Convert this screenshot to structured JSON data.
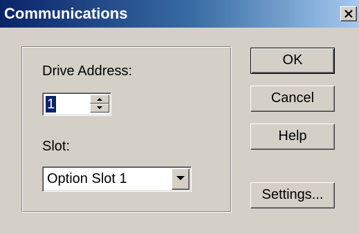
{
  "window": {
    "title": "Communications",
    "close_icon": "close-icon"
  },
  "drive_address": {
    "label": "Drive Address:",
    "value": "1",
    "spin_up_icon": "arrow-up-icon",
    "spin_down_icon": "arrow-down-icon"
  },
  "slot": {
    "label": "Slot:",
    "selected": "Option Slot 1",
    "dropdown_icon": "chevron-down-icon"
  },
  "buttons": {
    "ok": "OK",
    "cancel": "Cancel",
    "help": "Help",
    "settings": "Settings..."
  },
  "colors": {
    "title_gradient_start": "#0a246a",
    "title_gradient_end": "#a6caf0",
    "dialog_face": "#d4d0c8",
    "selection": "#0a246a"
  }
}
